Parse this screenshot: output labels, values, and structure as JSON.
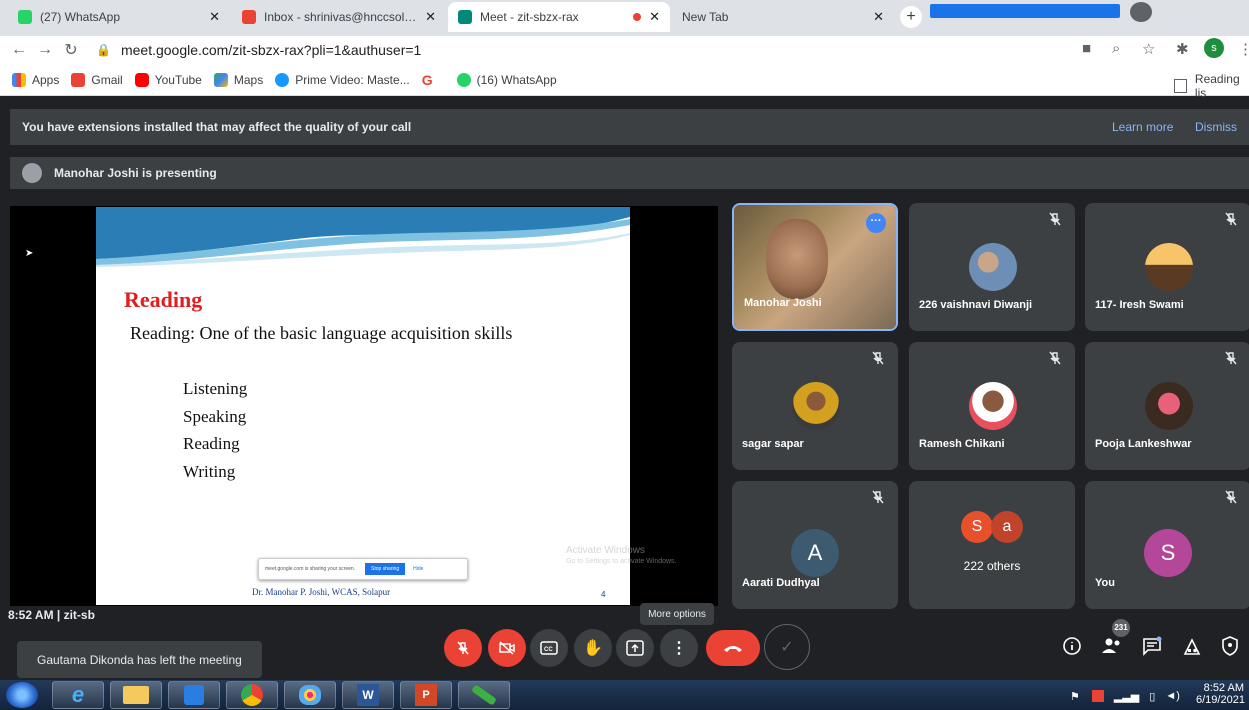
{
  "browser": {
    "tabs": [
      {
        "title": "(27) WhatsApp",
        "favicon_color": "#25d366"
      },
      {
        "title": "Inbox - shrinivas@hnccsolapur.org",
        "favicon_color": "#ea4335"
      },
      {
        "title": "Meet - zit-sbzx-rax",
        "favicon_color": "#00897b",
        "recording": true
      },
      {
        "title": "New Tab",
        "favicon_color": "#dadce0"
      }
    ],
    "url": "meet.google.com/zit-sbzx-rax?pli=1&authuser=1",
    "profile_initial": "s",
    "bookmarks": [
      {
        "label": "Apps",
        "icon": "apps-grid-icon"
      },
      {
        "label": "Gmail",
        "icon": "gmail-icon"
      },
      {
        "label": "YouTube",
        "icon": "youtube-icon"
      },
      {
        "label": "Maps",
        "icon": "maps-icon"
      },
      {
        "label": "Prime Video: Maste...",
        "icon": "prime-video-icon"
      },
      {
        "label": "",
        "icon": "google-icon"
      },
      {
        "label": "(16) WhatsApp",
        "icon": "whatsapp-icon"
      }
    ],
    "reading_list": "Reading lis"
  },
  "meet": {
    "banner": {
      "message": "You have extensions installed that may affect the quality of your call",
      "learn_more": "Learn more",
      "dismiss": "Dismiss"
    },
    "presenting": "Manohar Joshi is presenting",
    "slide": {
      "title": "Reading",
      "subtitle": "Reading: One of the basic language acquisition skills",
      "bullets": [
        "Listening",
        "Speaking",
        "Reading",
        "Writing"
      ],
      "footer": "Dr. Manohar P. Joshi, WCAS, Solapur",
      "page": "4",
      "share_bar": {
        "text": "meet.google.com is sharing your screen.",
        "stop": "Stop sharing",
        "hide": "Hide"
      }
    },
    "activate_windows": {
      "title": "Activate Windows",
      "subtitle": "Go to Settings to activate Windows."
    },
    "participants": [
      {
        "name": "Manohar Joshi",
        "type": "video"
      },
      {
        "name": "226 vaishnavi Diwanji",
        "type": "photo",
        "color": "#6d8fb5"
      },
      {
        "name": "117- Iresh Swami",
        "type": "photo",
        "color": "#e8a040"
      },
      {
        "name": "sagar sapar",
        "type": "photo",
        "color": "#d4a020"
      },
      {
        "name": "Ramesh Chikani",
        "type": "photo",
        "color": "#e85060"
      },
      {
        "name": "Pooja Lankeshwar",
        "type": "photo",
        "color": "#8a5040"
      },
      {
        "name": "Aarati Dudhyal",
        "type": "letter",
        "letter": "A",
        "color": "#3c5a70"
      },
      {
        "name": "222 others",
        "type": "others",
        "letters": [
          "S",
          "a"
        ],
        "colors": [
          "#e8502c",
          "#c0432a"
        ]
      },
      {
        "name": "You",
        "type": "letter",
        "letter": "S",
        "color": "#b5479b"
      }
    ],
    "clock_fragment": "8:52 AM  |  zit-sb",
    "toast": "Gautama Dikonda has left the meeting",
    "tooltip": "More options",
    "people_count": "231"
  },
  "taskbar": {
    "time": "8:52 AM",
    "date": "6/19/2021"
  }
}
